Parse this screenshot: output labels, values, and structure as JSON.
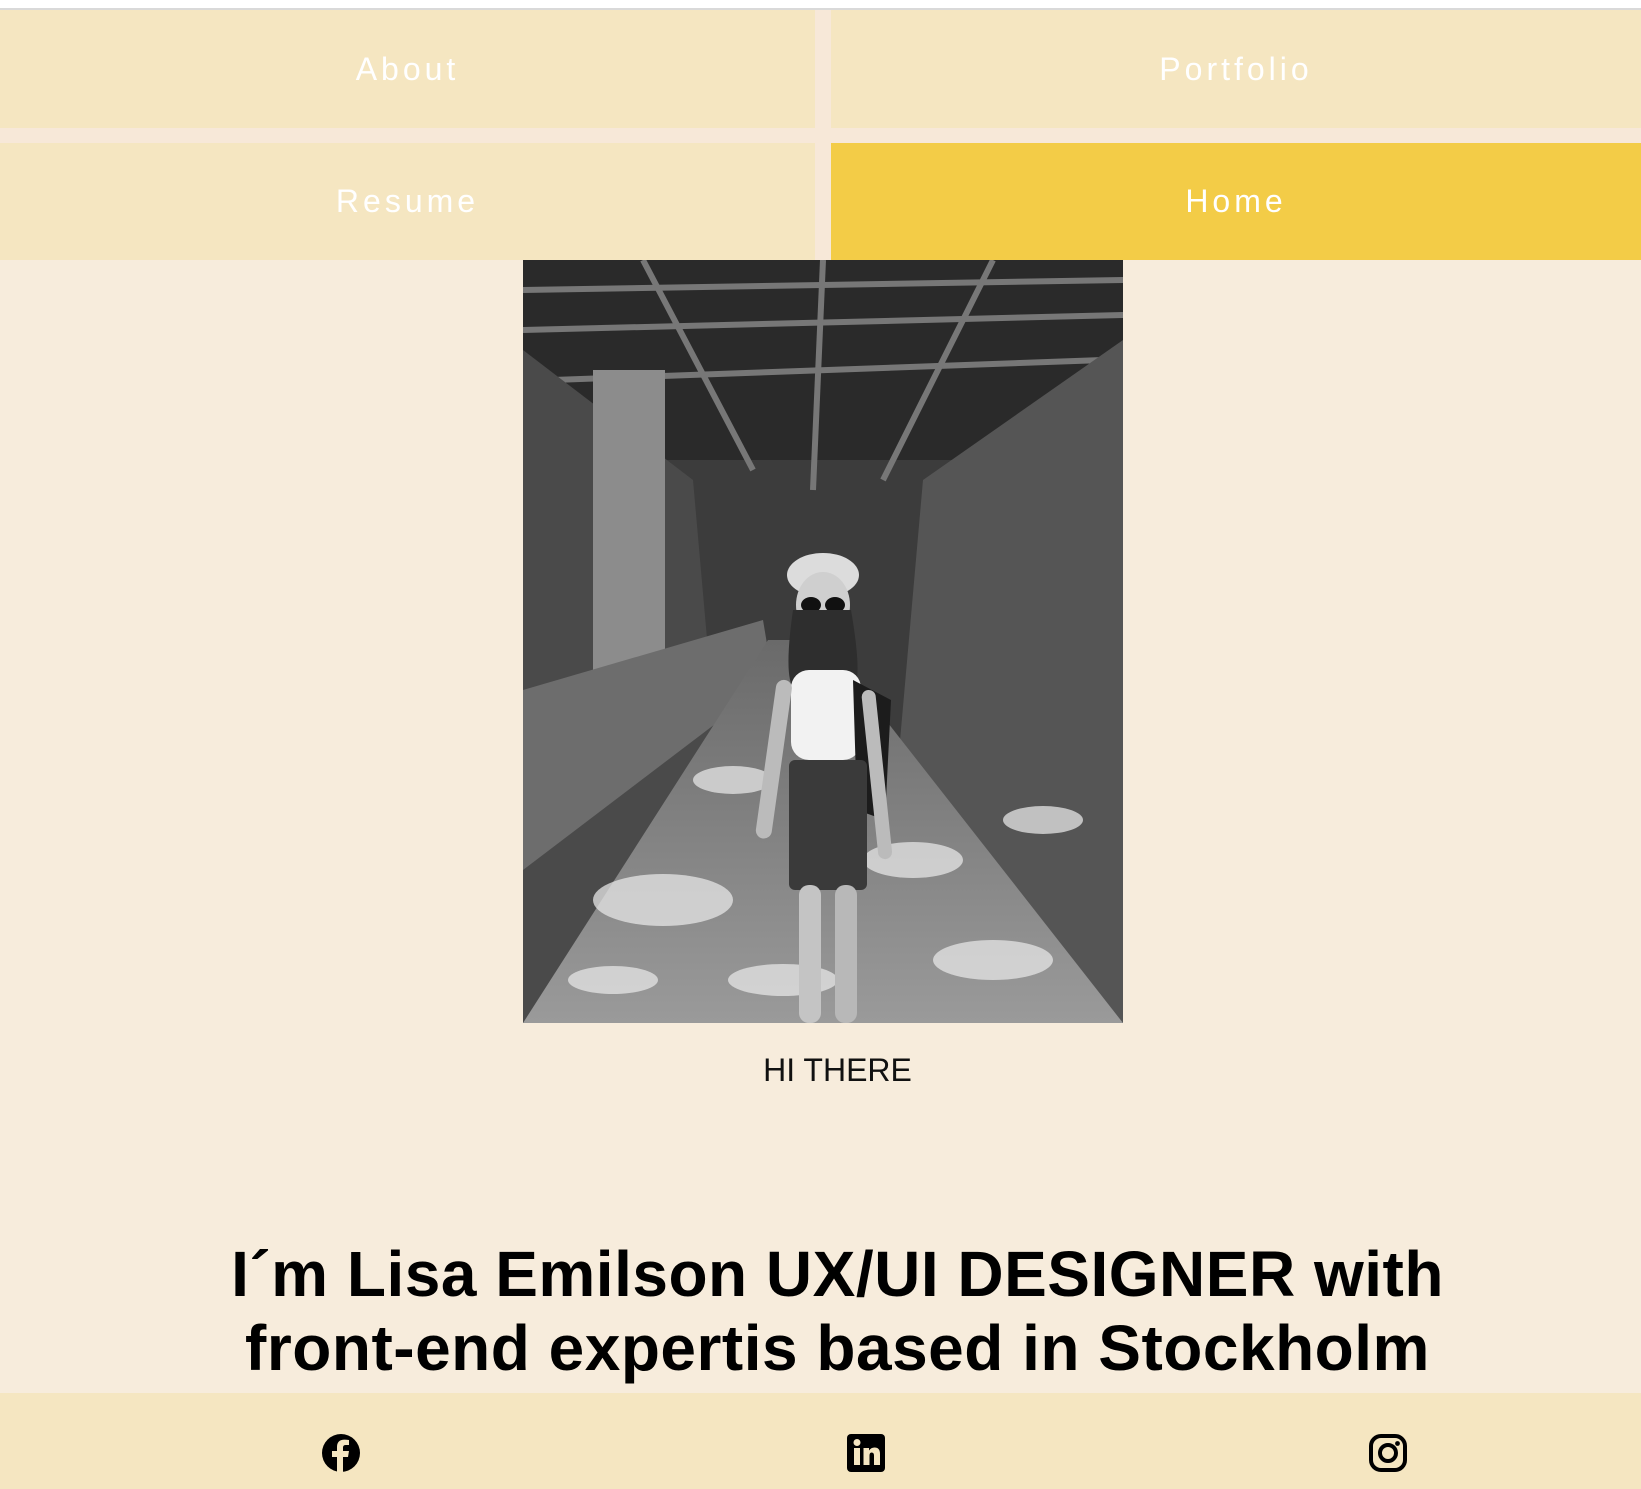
{
  "nav": {
    "items": [
      {
        "label": "About",
        "active": false
      },
      {
        "label": "Portfolio",
        "active": false
      },
      {
        "label": "Resume",
        "active": false
      },
      {
        "label": "Home",
        "active": true
      }
    ]
  },
  "hero": {
    "photo_icon": "portrait-photo",
    "greeting": "HI THERE",
    "headline_line1": "I´m Lisa Emilson UX/UI DESIGNER with",
    "headline_line2": "front-end expertis based in Stockholm"
  },
  "footer": {
    "social": [
      "facebook-icon",
      "linkedin-icon",
      "instagram-icon"
    ]
  },
  "colors": {
    "page_background": "#f7ecdc",
    "nav_background": "#f5e6c1",
    "nav_active": "#f3cc47",
    "nav_text": "#ffffff",
    "footer_background": "#f5e6c1"
  }
}
